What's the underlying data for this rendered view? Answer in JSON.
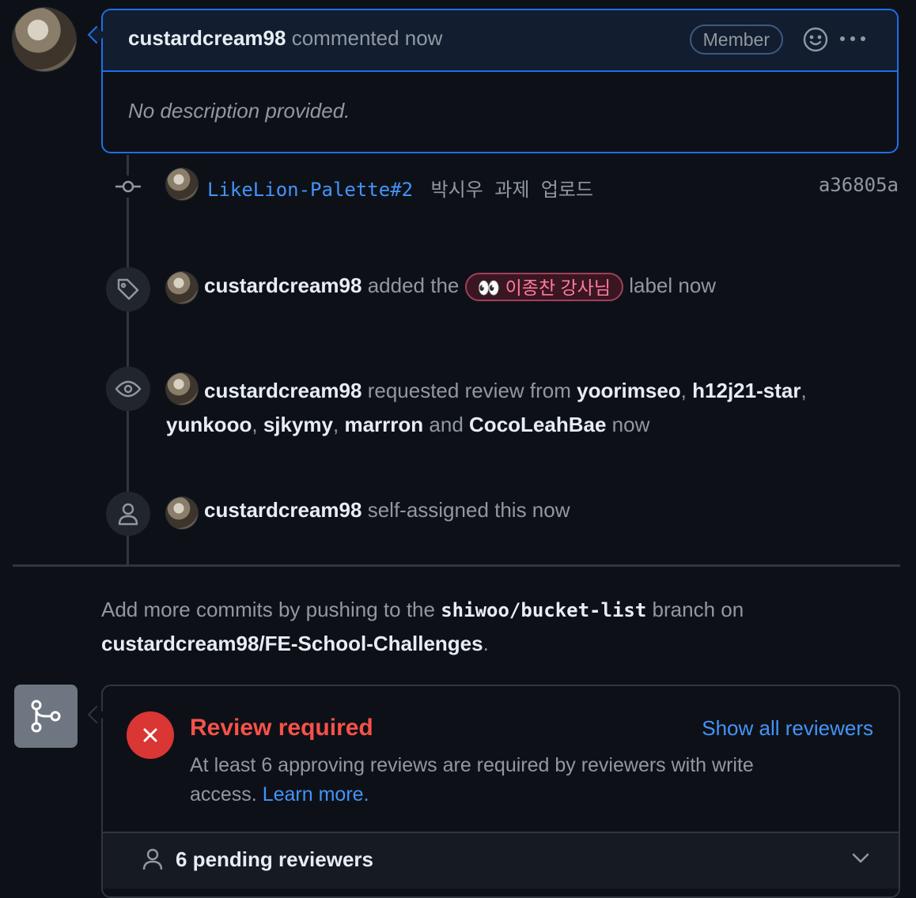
{
  "comment": {
    "author": "custardcream98",
    "action": "commented now",
    "badge": "Member",
    "body": "No description provided."
  },
  "commit": {
    "ref": "LikeLion-Palette#2",
    "message": "박시우 과제 업로드",
    "sha": "a36805a"
  },
  "events": {
    "label_event": {
      "actor": "custardcream98",
      "pre": "added the",
      "label": "👀 이종찬 강사님",
      "post": "label now"
    },
    "review_event": {
      "actor": "custardcream98",
      "pre": "requested review from",
      "reviewers": [
        "yoorimseo",
        "h12j21-star",
        "yunkooo",
        "sjkymy",
        "marrron",
        "CocoLeahBae"
      ],
      "sep": ",",
      "and": "and",
      "post": "now"
    },
    "assign_event": {
      "actor": "custardcream98",
      "post": "self-assigned this now"
    }
  },
  "hint": {
    "pre": "Add more commits by pushing to the",
    "branch": "shiwoo/bucket-list",
    "mid": "branch on",
    "repo": "custardcream98/FE-School-Challenges",
    "end": "."
  },
  "merge": {
    "title": "Review required",
    "description": "At least 6 approving reviews are required by reviewers with write access.",
    "learn_more": "Learn more.",
    "show_all": "Show all reviewers",
    "pending": "6 pending reviewers"
  },
  "colors": {
    "accent": "#4493f8",
    "danger": "#da3633",
    "danger_text": "#f85149"
  }
}
